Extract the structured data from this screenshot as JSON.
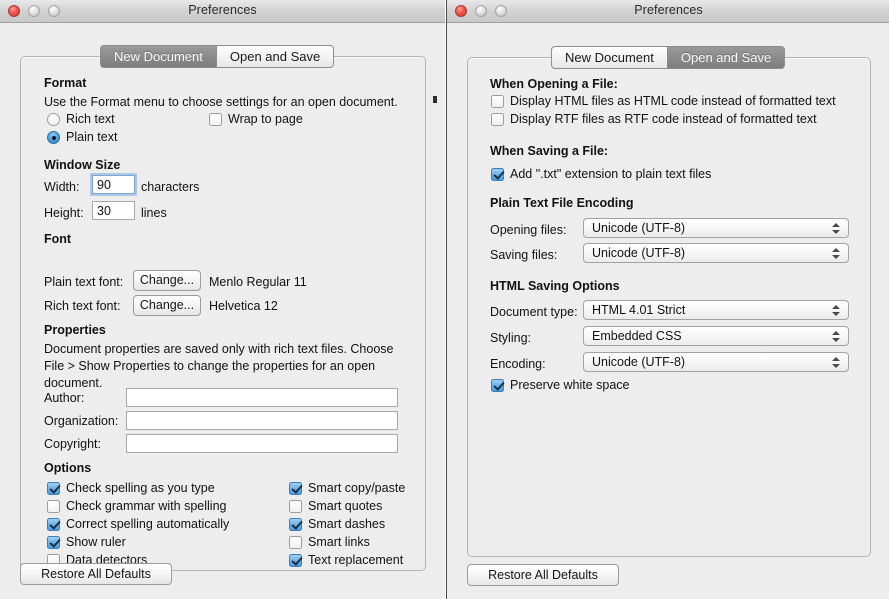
{
  "left_window": {
    "title": "Preferences",
    "traffic_lights": [
      "close-button",
      "minimize-button",
      "zoom-button"
    ],
    "tabs": [
      {
        "label": "New Document",
        "selected": true
      },
      {
        "label": "Open and Save",
        "selected": false
      }
    ],
    "format": {
      "heading": "Format",
      "description": "Use the Format menu to choose settings for an open document.",
      "rich_text": {
        "label": "Rich text",
        "selected": false
      },
      "plain_text": {
        "label": "Plain text",
        "selected": true
      },
      "wrap_to_page": {
        "label": "Wrap to page",
        "checked": false
      }
    },
    "window_size": {
      "heading": "Window Size",
      "width_label": "Width:",
      "width_value": "90",
      "width_unit": "characters",
      "height_label": "Height:",
      "height_value": "30",
      "height_unit": "lines"
    },
    "font": {
      "heading": "Font",
      "plain_label": "Plain text font:",
      "plain_button": "Change...",
      "plain_value": "Menlo Regular 11",
      "rich_label": "Rich text font:",
      "rich_button": "Change...",
      "rich_value": "Helvetica 12"
    },
    "properties": {
      "heading": "Properties",
      "description": "Document properties are saved only with rich text files. Choose File > Show Properties to change the properties for an open document.",
      "author_label": "Author:",
      "author_value": "",
      "organization_label": "Organization:",
      "organization_value": "",
      "copyright_label": "Copyright:",
      "copyright_value": ""
    },
    "options": {
      "heading": "Options",
      "column_one": [
        {
          "label": "Check spelling as you type",
          "checked": true
        },
        {
          "label": "Check grammar with spelling",
          "checked": false
        },
        {
          "label": "Correct spelling automatically",
          "checked": true
        },
        {
          "label": "Show ruler",
          "checked": true
        },
        {
          "label": "Data detectors",
          "checked": false
        }
      ],
      "column_two": [
        {
          "label": "Smart copy/paste",
          "checked": true
        },
        {
          "label": "Smart quotes",
          "checked": false
        },
        {
          "label": "Smart dashes",
          "checked": true
        },
        {
          "label": "Smart links",
          "checked": false
        },
        {
          "label": "Text replacement",
          "checked": true
        }
      ]
    },
    "restore_button": "Restore All Defaults"
  },
  "right_window": {
    "title": "Preferences",
    "traffic_lights": [
      "close-button",
      "minimize-button",
      "zoom-button"
    ],
    "tabs": [
      {
        "label": "New Document",
        "selected": false
      },
      {
        "label": "Open and Save",
        "selected": true
      }
    ],
    "opening": {
      "heading": "When Opening a File:",
      "items": [
        {
          "label": "Display HTML files as HTML code instead of formatted text",
          "checked": false
        },
        {
          "label": "Display RTF files as RTF code instead of formatted text",
          "checked": false
        }
      ]
    },
    "saving": {
      "heading": "When Saving a File:",
      "items": [
        {
          "label": "Add \".txt\" extension to plain text files",
          "checked": true
        }
      ]
    },
    "plain_text_encoding": {
      "heading": "Plain Text File Encoding",
      "opening_label": "Opening files:",
      "opening_value": "Unicode (UTF-8)",
      "saving_label": "Saving files:",
      "saving_value": "Unicode (UTF-8)"
    },
    "html_saving": {
      "heading": "HTML Saving Options",
      "doctype_label": "Document type:",
      "doctype_value": "HTML 4.01 Strict",
      "styling_label": "Styling:",
      "styling_value": "Embedded CSS",
      "encoding_label": "Encoding:",
      "encoding_value": "Unicode (UTF-8)",
      "preserve_label": "Preserve white space",
      "preserve_checked": true
    },
    "restore_button": "Restore All Defaults"
  },
  "colors": {
    "window_bg": "#ededed",
    "accent_blue": "#4f9ade",
    "selected_tab": "#8c8c8c",
    "text": "#121212"
  }
}
